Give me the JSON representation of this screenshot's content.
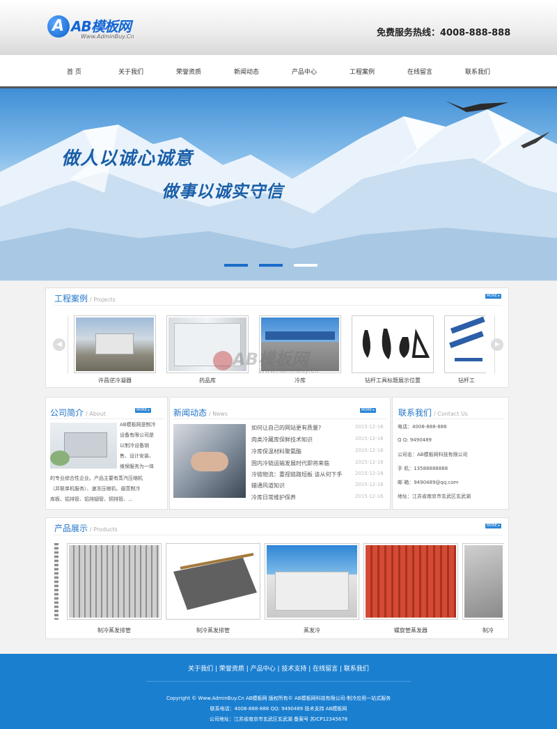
{
  "header": {
    "logo_text": "AB模板网",
    "logo_letter": "A",
    "logo_sub": "Www.AdminBuy.Cn",
    "hotline": "免费服务热线：4008-888-888"
  },
  "nav": [
    "首 页",
    "关于我们",
    "荣誉资质",
    "新闻动态",
    "产品中心",
    "工程案例",
    "在线留言",
    "联系我们"
  ],
  "banner": {
    "slogan1": "做人以诚心诚意",
    "slogan2": "做事以诚实守信",
    "active_dot": 3
  },
  "projects": {
    "title": "工程案例",
    "title_en": "/ Projects",
    "more": "MORE ▸",
    "items": [
      "许昌逆冷凝器",
      "药品库",
      "冷库",
      "钻杆工具标题展示位置",
      "钻杆工"
    ]
  },
  "about": {
    "title": "公司简介",
    "title_en": "/ About",
    "more": "MORE ▸",
    "text_side": [
      "AB模板网是制冷",
      "设备有限公司是",
      "以制冷设备销",
      "售、设计安装、",
      "维保服务为一体"
    ],
    "text_full": [
      "的专业综合性企业。产品主要有蒸汽压缩机",
      "（并联单机服务）、速冻压缩机、翅蒸制冷",
      "库板、铝排管、铝排翅管、铜排管、..."
    ]
  },
  "news": {
    "title": "新闻动态",
    "title_en": "/ News",
    "more": "MORE ▸",
    "items": [
      {
        "t": "如何让自己的网站更有质量?",
        "d": "2015-12-16"
      },
      {
        "t": "肉类冷藏库保鲜技术知识",
        "d": "2015-12-16"
      },
      {
        "t": "冷库保温材料聚氨酯",
        "d": "2015-12-16"
      },
      {
        "t": "国内冷链运输发展时代即将来临",
        "d": "2015-12-16"
      },
      {
        "t": "冷链物流：重视链路短板 该从何下手",
        "d": "2015-12-16"
      },
      {
        "t": "蜡通风道知识",
        "d": "2015-12-16"
      },
      {
        "t": "冷库日常维护保养",
        "d": "2015-12-16"
      }
    ]
  },
  "contact": {
    "title": "联系我们",
    "title_en": "/ Contact Us",
    "lines": [
      "电话：4008-888-888",
      "Q Q: 9490489",
      "公司名：AB模板网科技有限公司",
      "手  机：13588888888",
      "邮  箱：9490489@qq.com",
      "地址：江苏省南京市玄武区玄武湖"
    ]
  },
  "products": {
    "title": "产品展示",
    "title_en": "/ Products",
    "more": "MORE ▸",
    "items": [
      "制冷蒸发排管",
      "制冷蒸发排管",
      "蒸发冷",
      "螺旋管蒸发器",
      "制冷"
    ]
  },
  "watermark": {
    "text": "AB模板网",
    "sub": "Www.AdminBuy.Cn"
  },
  "footer": {
    "links": "关于我们  |  荣誉资质  |  产品中心  |  技术支持  |  在线留言  |  联系我们",
    "line1": "Copyright © Www.AdminBuy.Cn AB模板网 版权所有© AB模板网科技有限公司-制冷应用一站式服务",
    "line2": "联系电话：4008-888-888 QQ: 9490489 技术支持 AB模板网",
    "line3": "公司地址：江苏省南京市玄武区玄武湖  备案号  苏ICP12345678"
  },
  "colors": {
    "accent": "#1e73c8",
    "footer": "#1b7fd0"
  }
}
